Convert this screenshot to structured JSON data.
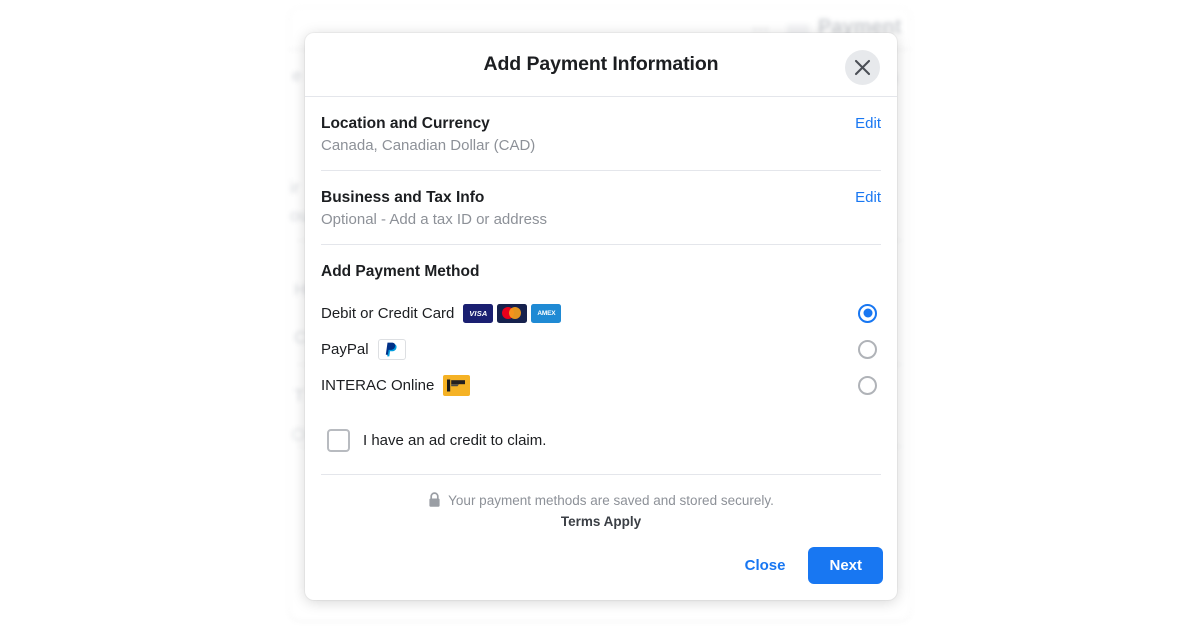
{
  "background": {
    "page_title": "Payment",
    "menu_icon": "ellipsis-icon",
    "fragments": [
      "e",
      "ir",
      "ou",
      "H",
      "C",
      "T",
      "c",
      "n"
    ]
  },
  "modal": {
    "title": "Add Payment Information",
    "close_icon": "close-icon",
    "sections": [
      {
        "title": "Location and Currency",
        "subtitle": "Canada, Canadian Dollar (CAD)",
        "action_label": "Edit"
      },
      {
        "title": "Business and Tax Info",
        "subtitle": "Optional - Add a tax ID or address",
        "action_label": "Edit"
      }
    ],
    "payment_methods": {
      "title": "Add Payment Method",
      "options": [
        {
          "label": "Debit or Credit Card",
          "selected": true,
          "logos": [
            {
              "name": "visa-logo",
              "text": "VISA"
            },
            {
              "name": "mastercard-logo",
              "text": ""
            },
            {
              "name": "amex-logo",
              "text": "AMEX"
            }
          ]
        },
        {
          "label": "PayPal",
          "selected": false,
          "logos": [
            {
              "name": "paypal-logo",
              "text": "P"
            }
          ]
        },
        {
          "label": "INTERAC Online",
          "selected": false,
          "logos": [
            {
              "name": "interac-logo",
              "text": ""
            }
          ]
        }
      ]
    },
    "ad_credit": {
      "label": "I have an ad credit to claim.",
      "checked": false
    },
    "security": {
      "icon": "lock-icon",
      "text": "Your payment methods are saved and stored securely.",
      "terms": "Terms Apply"
    },
    "footer": {
      "close_label": "Close",
      "next_label": "Next"
    }
  },
  "colors": {
    "accent": "#1877f2",
    "text": "#1c1e21",
    "muted": "#8d9198",
    "visa": "#1a1f71",
    "mastercard": "#16214d",
    "amex": "#1f8ad4",
    "interac": "#f5b225"
  }
}
